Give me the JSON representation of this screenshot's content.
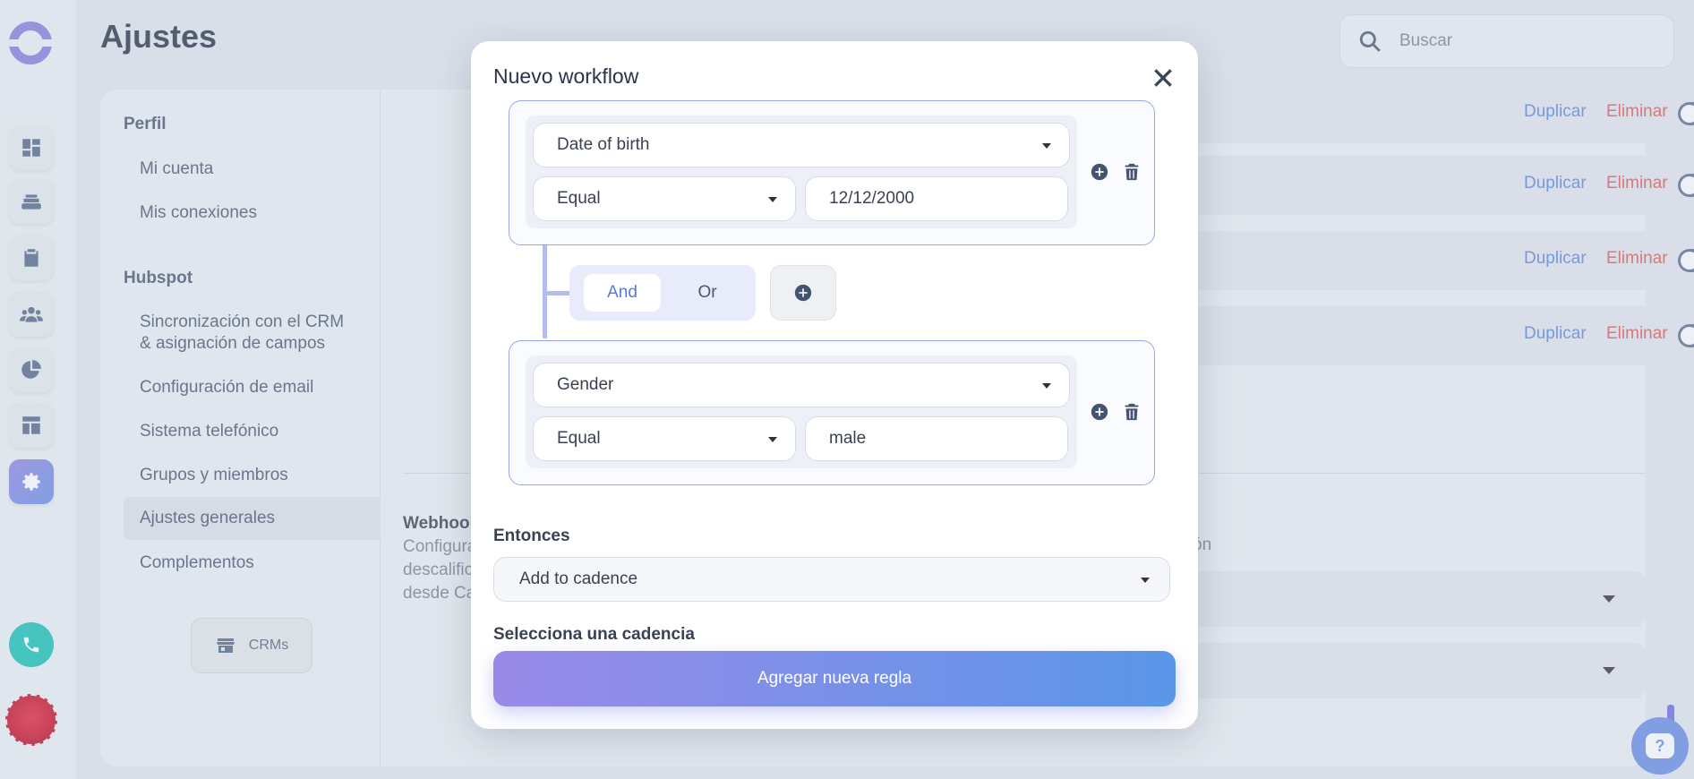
{
  "header": {
    "title": "Ajustes",
    "search_placeholder": "Buscar"
  },
  "settings_nav": {
    "sections": [
      {
        "title": "Perfil",
        "items": [
          "Mi cuenta",
          "Mis conexiones"
        ]
      },
      {
        "title": "Hubspot",
        "items": [
          "Sincronización con el CRM & asignación de campos",
          "Configuración de email",
          "Sistema telefónico",
          "Grupos y miembros",
          "Ajustes generales",
          "Complementos"
        ]
      }
    ],
    "active_item": "Ajustes generales",
    "crm_button": "CRMs"
  },
  "workflow_rows": [
    {
      "duplicate": "Duplicar",
      "delete": "Eliminar",
      "enabled": false
    },
    {
      "duplicate": "Duplicar",
      "delete": "Eliminar",
      "enabled": false
    },
    {
      "duplicate": "Duplicar",
      "delete": "Eliminar",
      "enabled": false
    },
    {
      "duplicate": "Duplicar",
      "delete": "Eliminar",
      "enabled": false
    }
  ],
  "webhook": {
    "title": "Webhook",
    "desc_lines": [
      "Configura",
      "descalific",
      "desde Ca"
    ],
    "desc_tail": "ón"
  },
  "modal": {
    "title": "Nuevo workflow",
    "conditions": [
      {
        "field": "Date of birth",
        "operator": "Equal",
        "value": "12/12/2000"
      },
      {
        "field": "Gender",
        "operator": "Equal",
        "value": "male"
      }
    ],
    "logic": {
      "and_label": "And",
      "or_label": "Or",
      "selected": "And"
    },
    "then_label": "Entonces",
    "then_value": "Add to cadence",
    "cadence_label": "Selecciona una cadencia",
    "submit_label": "Agregar nueva regla"
  },
  "colors": {
    "accent": "#6a8ee8",
    "delete": "#e05a5a",
    "duplicate": "#5a88d8",
    "phone": "#18c2b8"
  }
}
